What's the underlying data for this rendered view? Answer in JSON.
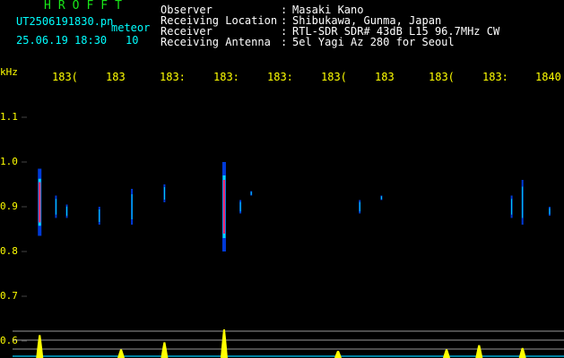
{
  "header": {
    "station_name": "HROFFT",
    "file_name": "UT2506191830.pn",
    "mode_label": "meteor",
    "date_time": "25.06.19 18:30",
    "count": "10",
    "fields": [
      {
        "label": "Observer",
        "value": "Masaki Kano"
      },
      {
        "label": "Receiving Location",
        "value": "Shibukawa, Gunma, Japan"
      },
      {
        "label": "Receiver",
        "value": "RTL-SDR SDR# 43dB L15 96.7MHz CW"
      },
      {
        "label": "Receiving Antenna",
        "value": "5el Yagi Az 280 for Seoul"
      }
    ]
  },
  "axes": {
    "y_unit": "kHz",
    "y_ticks": [
      "1.1",
      "1.0",
      "0.9",
      "0.8",
      "0.7",
      "0.6"
    ],
    "x_ticks": [
      "183(",
      "183",
      "183:",
      "183:",
      "183:",
      "183(",
      "183",
      "183(",
      "183:",
      "1840"
    ]
  },
  "colors": {
    "background": "#000000",
    "text": "#ffffff",
    "station": "#19e619",
    "axis_labels": "#ffff00",
    "signal_weak": "#0044ff",
    "signal_mid": "#00ffff",
    "signal_strong": "#ff2266",
    "power_trace": "#ffff00"
  },
  "chart_data": {
    "type": "heatmap",
    "y_unit": "kHz",
    "y_range": [
      0.58,
      1.15
    ],
    "x_range": [
      1830,
      1840
    ],
    "echoes": [
      {
        "t": 1830.5,
        "f_center": 0.91,
        "f_span": 0.15,
        "intensity": 0.8
      },
      {
        "t": 1830.8,
        "f_center": 0.9,
        "f_span": 0.05,
        "intensity": 0.4
      },
      {
        "t": 1831.0,
        "f_center": 0.89,
        "f_span": 0.03,
        "intensity": 0.3
      },
      {
        "t": 1831.6,
        "f_center": 0.88,
        "f_span": 0.04,
        "intensity": 0.3
      },
      {
        "t": 1832.2,
        "f_center": 0.9,
        "f_span": 0.08,
        "intensity": 0.5
      },
      {
        "t": 1832.8,
        "f_center": 0.93,
        "f_span": 0.04,
        "intensity": 0.5
      },
      {
        "t": 1833.9,
        "f_center": 0.9,
        "f_span": 0.2,
        "intensity": 1.0
      },
      {
        "t": 1834.2,
        "f_center": 0.9,
        "f_span": 0.03,
        "intensity": 0.3
      },
      {
        "t": 1834.4,
        "f_center": 0.93,
        "f_span": 0.01,
        "intensity": 0.3
      },
      {
        "t": 1836.4,
        "f_center": 0.9,
        "f_span": 0.03,
        "intensity": 0.4
      },
      {
        "t": 1836.8,
        "f_center": 0.92,
        "f_span": 0.01,
        "intensity": 0.3
      },
      {
        "t": 1839.2,
        "f_center": 0.9,
        "f_span": 0.05,
        "intensity": 0.4
      },
      {
        "t": 1839.4,
        "f_center": 0.91,
        "f_span": 0.1,
        "intensity": 0.6
      },
      {
        "t": 1839.9,
        "f_center": 0.89,
        "f_span": 0.02,
        "intensity": 0.3
      }
    ],
    "power_peaks": [
      {
        "t": 1830.5,
        "level": 0.8
      },
      {
        "t": 1832.0,
        "level": 0.3
      },
      {
        "t": 1832.8,
        "level": 0.55
      },
      {
        "t": 1833.9,
        "level": 1.0
      },
      {
        "t": 1836.0,
        "level": 0.25
      },
      {
        "t": 1838.0,
        "level": 0.3
      },
      {
        "t": 1838.6,
        "level": 0.45
      },
      {
        "t": 1839.4,
        "level": 0.35
      }
    ]
  }
}
